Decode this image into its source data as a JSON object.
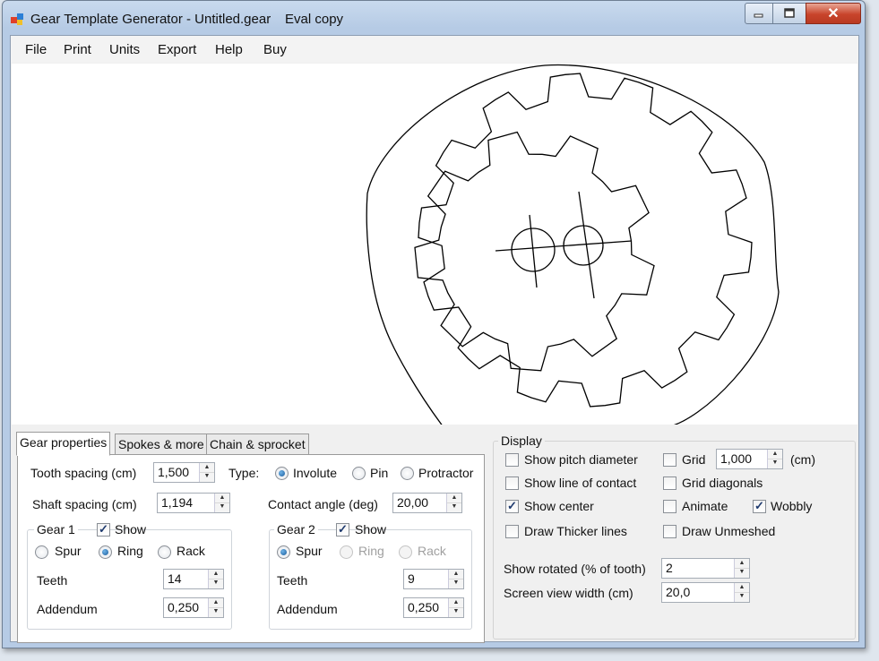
{
  "window": {
    "title": "Gear Template Generator - Untitled.gear",
    "eval_note": "Eval copy"
  },
  "titlebar_buttons": {
    "minimize_icon": "minimize-icon",
    "maximize_icon": "maximize-icon",
    "close_icon": "close-icon",
    "close_glyph": "✕"
  },
  "menu": [
    "File",
    "Print",
    "Units",
    "Export",
    "Help",
    "Buy"
  ],
  "tabs": [
    "Gear properties",
    "Spokes & more",
    "Chain & sprocket"
  ],
  "gear_properties": {
    "tooth_spacing_label": "Tooth spacing (cm)",
    "tooth_spacing_value": "1,500",
    "type_label": "Type:",
    "type_options": [
      "Involute",
      "Pin",
      "Protractor"
    ],
    "type_selected": "Involute",
    "shaft_spacing_label": "Shaft spacing (cm)",
    "shaft_spacing_value": "1,194",
    "contact_angle_label": "Contact angle (deg)",
    "contact_angle_value": "20,00",
    "gear1": {
      "title": "Gear 1",
      "show_label": "Show",
      "show_checked": true,
      "options": [
        "Spur",
        "Ring",
        "Rack"
      ],
      "selected": "Ring",
      "teeth_label": "Teeth",
      "teeth_value": "14",
      "addendum_label": "Addendum",
      "addendum_value": "0,250"
    },
    "gear2": {
      "title": "Gear 2",
      "show_label": "Show",
      "show_checked": true,
      "options": [
        "Spur",
        "Ring",
        "Rack"
      ],
      "selected": "Spur",
      "teeth_label": "Teeth",
      "teeth_value": "9",
      "addendum_label": "Addendum",
      "addendum_value": "0,250"
    }
  },
  "display": {
    "title": "Display",
    "show_pitch_diameter": {
      "label": "Show pitch diameter",
      "checked": false
    },
    "show_line_of_contact": {
      "label": "Show line of contact",
      "checked": false
    },
    "show_center": {
      "label": "Show center",
      "checked": true
    },
    "draw_thicker_lines": {
      "label": "Draw Thicker lines",
      "checked": false
    },
    "grid": {
      "label": "Grid",
      "checked": false,
      "value": "1,000",
      "unit": "(cm)"
    },
    "grid_diagonals": {
      "label": "Grid diagonals",
      "checked": false
    },
    "animate": {
      "label": "Animate",
      "checked": false
    },
    "wobbly": {
      "label": "Wobbly",
      "checked": true
    },
    "draw_unmeshed": {
      "label": "Draw Unmeshed",
      "checked": false
    },
    "show_rotated_label": "Show rotated (% of tooth)",
    "show_rotated_value": "2",
    "screen_view_width_label": "Screen view width (cm)",
    "screen_view_width_value": "20,0"
  },
  "gear_drawing": {
    "ring_gear_teeth": 14,
    "spur_gear_teeth": 9
  }
}
